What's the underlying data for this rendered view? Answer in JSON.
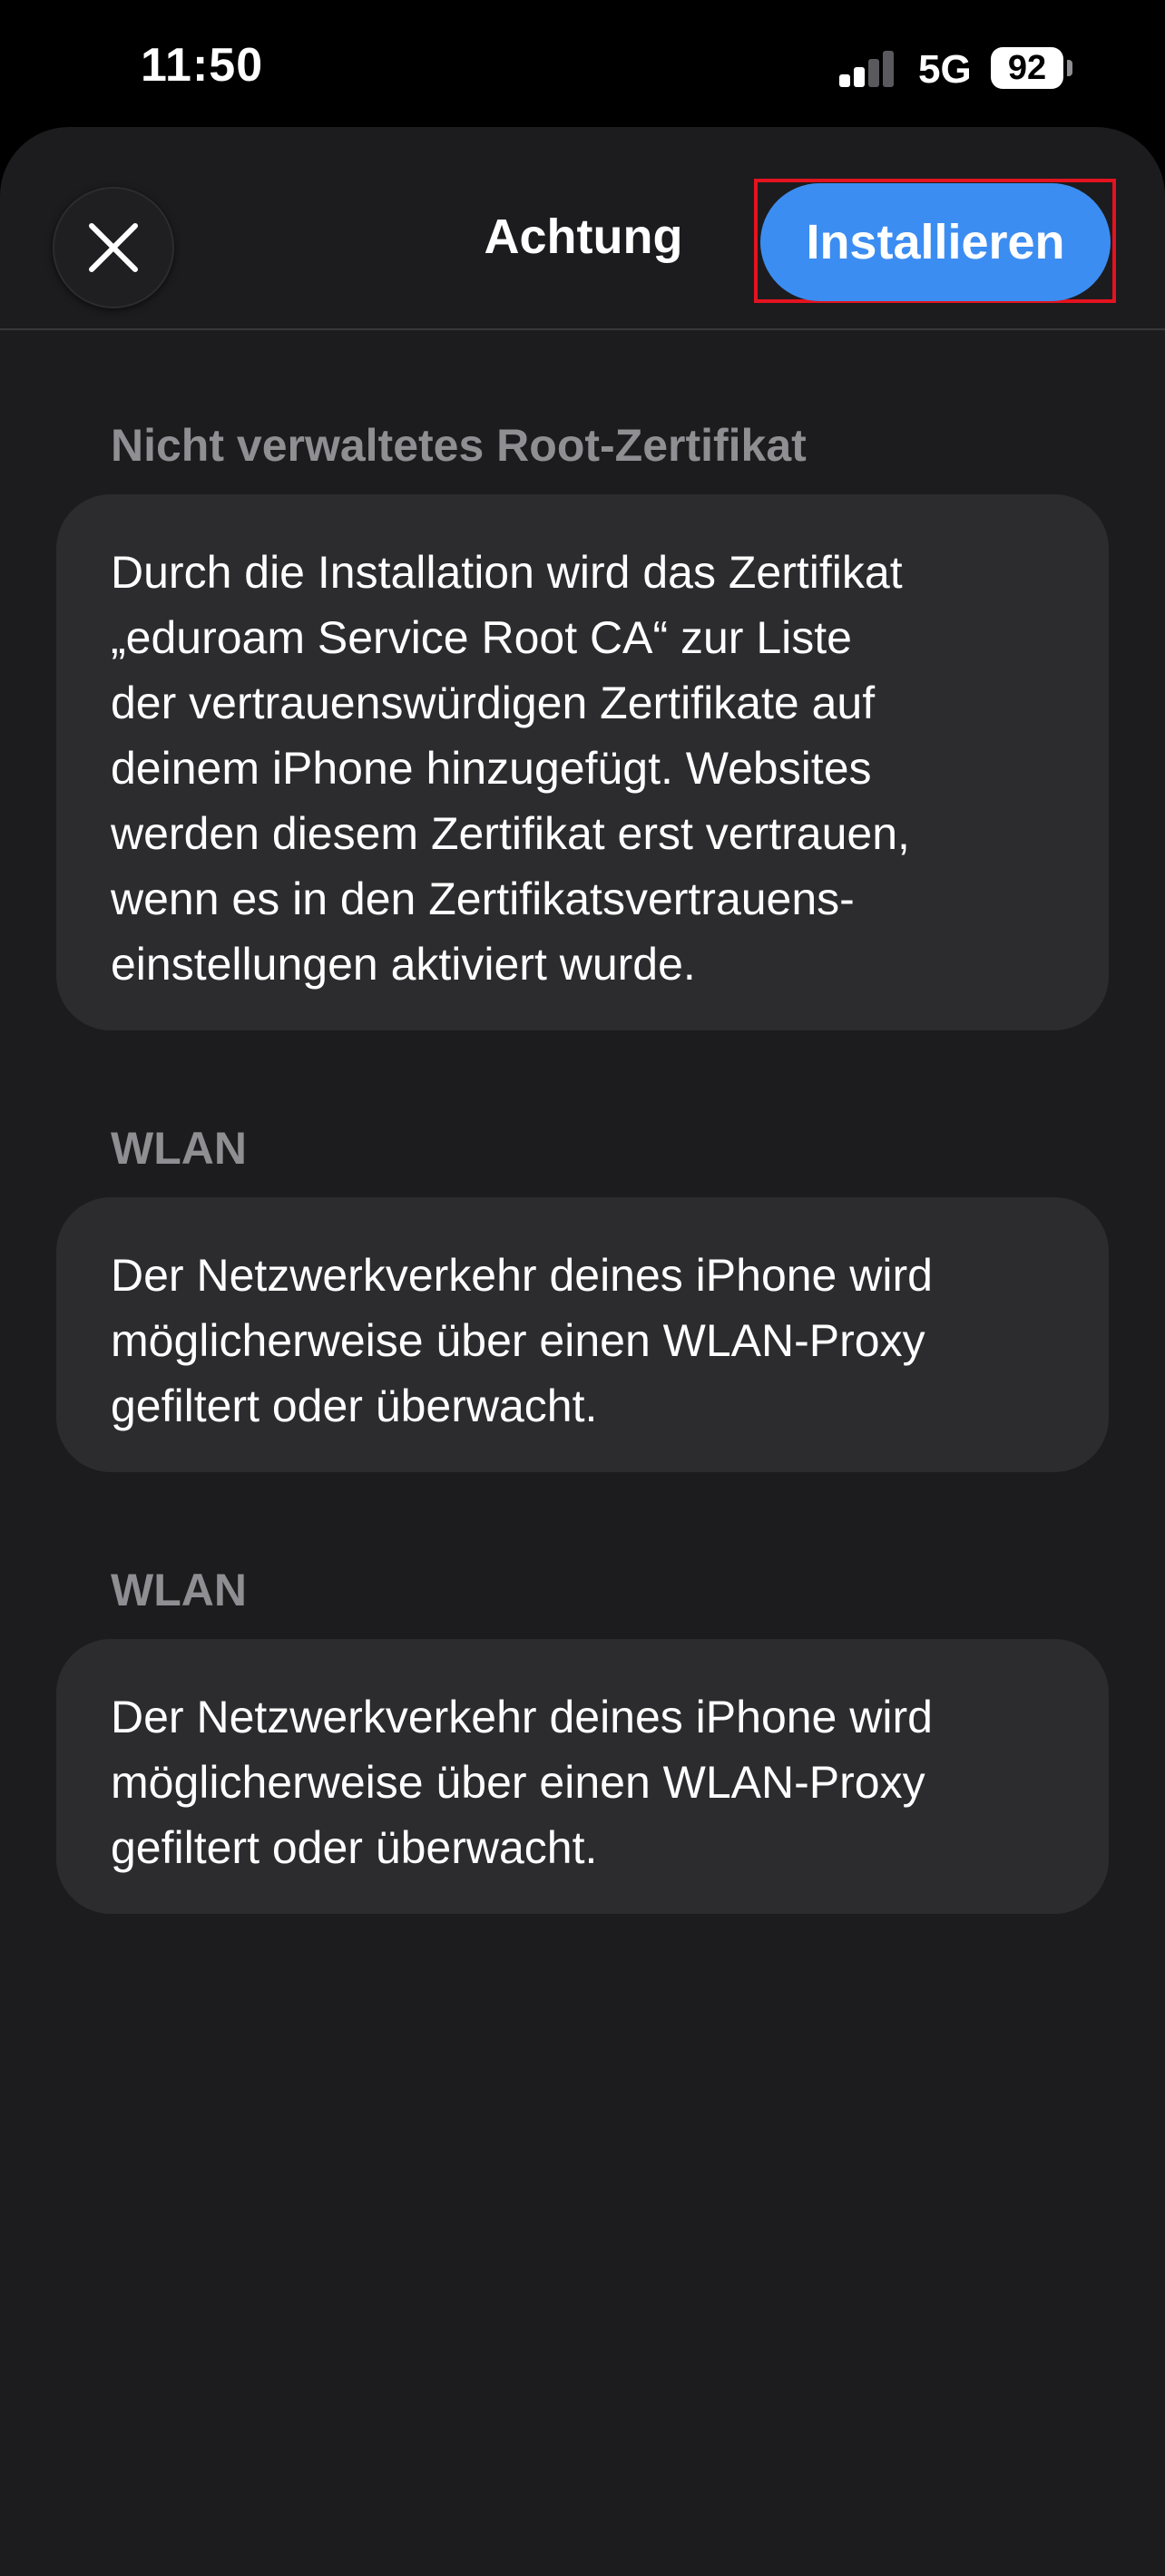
{
  "status_bar": {
    "time": "11:50",
    "network": "5G",
    "battery": "92",
    "signal_bars_active": 2,
    "signal_bars_total": 4
  },
  "nav": {
    "close_icon": "close-icon",
    "title": "Achtung",
    "install_label": "Installieren"
  },
  "sections": [
    {
      "header": "Nicht verwaltetes Root-Zertifikat",
      "lines": [
        "Durch die Installation wird das Zertifikat",
        "„eduroam Service Root CA“ zur Liste",
        "der vertrauenswürdigen Zertifikate auf",
        "deinem iPhone hinzugefügt. Websites",
        "werden diesem Zertifikat erst vertrauen,",
        "wenn es in den Zertifikatsvertrauens-",
        "einstellungen aktiviert wurde."
      ]
    },
    {
      "header": "WLAN",
      "lines": [
        "Der Netzwerkverkehr deines iPhone wird",
        "möglicherweise über einen WLAN-Proxy",
        "gefiltert oder überwacht."
      ]
    },
    {
      "header": "WLAN",
      "lines": [
        "Der Netzwerkverkehr deines iPhone wird",
        "möglicherweise über einen WLAN-Proxy",
        "gefiltert oder überwacht."
      ]
    }
  ],
  "colors": {
    "accent": "#3c8df2",
    "highlight": "#e3131f",
    "background": "#1c1c1e",
    "card": "#2c2c2e",
    "secondary_text": "#8e8e93"
  }
}
